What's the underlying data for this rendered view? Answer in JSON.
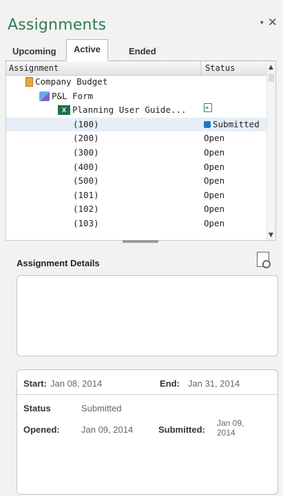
{
  "pane": {
    "title": "Assignments",
    "dropdown_icon": "▾",
    "close_icon": "✕"
  },
  "tabs": [
    {
      "label": "Upcoming"
    },
    {
      "label": "Active",
      "active": true
    },
    {
      "label": "Ended"
    }
  ],
  "grid": {
    "columns": {
      "assignment": "Assignment",
      "status": "Status"
    },
    "rows": [
      {
        "name": "Company Budget",
        "icon": "budget-icon",
        "status": ""
      },
      {
        "name": "P&L Form",
        "icon": "form-icon",
        "status": ""
      },
      {
        "name": "Planning User Guide...",
        "icon": "excel-icon",
        "status": "",
        "status_icon": "open-file-icon"
      },
      {
        "name": "(100)",
        "status": "Submitted",
        "status_icon": "submitted-square-icon",
        "selected": true
      },
      {
        "name": "(200)",
        "status": "Open"
      },
      {
        "name": "(300)",
        "status": "Open"
      },
      {
        "name": "(400)",
        "status": "Open"
      },
      {
        "name": "(500)",
        "status": "Open"
      },
      {
        "name": "(101)",
        "status": "Open"
      },
      {
        "name": "(102)",
        "status": "Open"
      },
      {
        "name": "(103)",
        "status": "Open"
      }
    ]
  },
  "details": {
    "title": "Assignment Details"
  },
  "info": {
    "start_label": "Start:",
    "start_value": "Jan 08, 2014",
    "end_label": "End:",
    "end_value": "Jan 31, 2014",
    "status_label": "Status",
    "status_value": "Submitted",
    "opened_label": "Opened:",
    "opened_value": "Jan 09, 2014",
    "submitted_label": "Submitted:",
    "submitted_value_1": "Jan 09,",
    "submitted_value_2": "2014"
  },
  "colors": {
    "title": "#2e7d4f",
    "selected_row": "#e6eef8",
    "submitted_square": "#1e74d0"
  }
}
